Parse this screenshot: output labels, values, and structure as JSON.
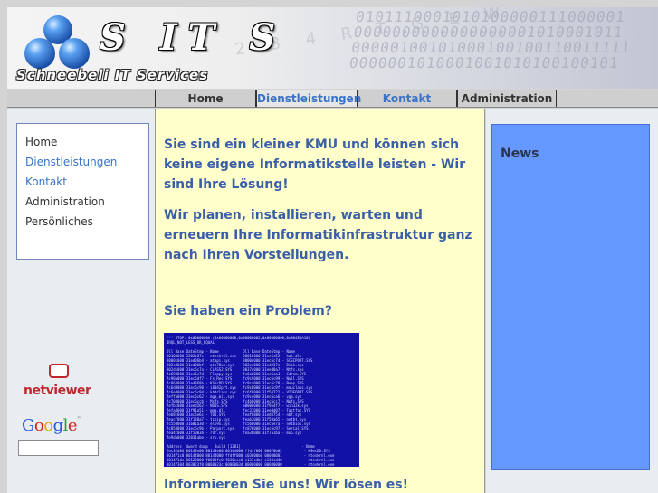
{
  "header": {
    "brand": "S IT S",
    "tagline": "Schneebeli IT Services"
  },
  "nav": {
    "home": "Home",
    "dienstleistungen": "Dienstleistungen",
    "kontakt": "Kontakt",
    "administration": "Administration"
  },
  "sidebar": {
    "items": [
      {
        "label": "Home",
        "color": "#333333"
      },
      {
        "label": "Dienstleistungen",
        "color": "#3a73c8"
      },
      {
        "label": "Kontakt",
        "color": "#3a73c8"
      },
      {
        "label": "Administration",
        "color": "#333333"
      },
      {
        "label": "Persönliches",
        "color": "#333333"
      }
    ],
    "netviewer": "netviewer",
    "google": "Google",
    "search_placeholder": ""
  },
  "main": {
    "intro": "Sie sind ein kleiner KMU und können sich keine eigene Informatikstelle leisten - Wir sind Ihre Lösung!",
    "plan": "Wir planen, installieren, warten und erneuern Ihre Informatikinfrastruktur ganz nach Ihren Vorstellungen.",
    "problem": "Sie haben ein Problem?",
    "inform": "Informieren Sie uns! Wir lösen es!"
  },
  "news": {
    "title": "News"
  },
  "colors": {
    "accent_blue": "#3a73c8",
    "main_bg": "#ffffcc",
    "news_bg": "#6699ff",
    "netviewer_red": "#c0282d"
  },
  "icons": {
    "logo": "three-blue-spheres-logo",
    "netviewer": "speech-bubble-icon",
    "screenshot": "blue-screen-image"
  }
}
